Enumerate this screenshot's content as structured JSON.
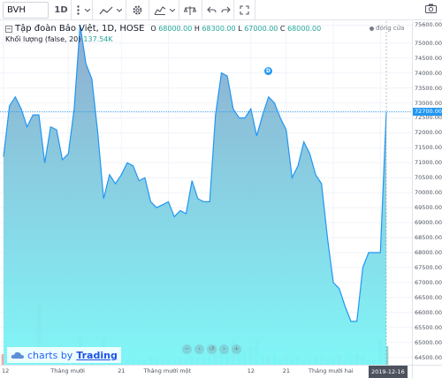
{
  "toolbar": {
    "symbol": "BVH",
    "interval": "1D",
    "more_icon": "more-vertical-icon",
    "chart_type_icon": "line-chart-icon",
    "settings_icon": "gear-icon",
    "indicators_icon": "indicators-icon",
    "compare_icon": "compare-icon",
    "undo_icon": "undo-icon",
    "redo_icon": "redo-icon",
    "fullscreen_icon": "fullscreen-icon",
    "snapshot_icon": "camera-icon"
  },
  "legend": {
    "title": "Tập đoàn Bảo Việt, 1D, HOSE",
    "o_label": "O",
    "o_value": "68000.00",
    "h_label": "H",
    "h_value": "68300.00",
    "l_label": "L",
    "l_value": "67000.00",
    "c_label": "C",
    "c_value": "68000.00",
    "volume_label": "Khối lượng (false, 20)",
    "volume_value": "137.54K"
  },
  "market_status": "đóng cửa",
  "dividend_marker": "D",
  "watermark": {
    "prefix": "charts by",
    "brand": "Trading"
  },
  "time_cursor": "2019-12-16",
  "colors": {
    "line": "#2196f3",
    "area_top": "#8ab7d6",
    "area_bottom": "#78f2f6",
    "volume_up": "#26a69a",
    "volume_down": "#ef5350",
    "last_price_bg": "#2196f3"
  },
  "chart_data": {
    "type": "area",
    "title": "Tập đoàn Bảo Việt, 1D, HOSE",
    "price_ticks": [
      "75600.00",
      "75000.00",
      "74500.00",
      "74000.00",
      "73500.00",
      "73000.00",
      "72500.00",
      "72000.00",
      "71500.00",
      "71000.00",
      "70500.00",
      "70000.00",
      "69500.00",
      "69000.00",
      "68500.00",
      "68000.00",
      "67500.00",
      "67000.00",
      "66500.00",
      "66000.00",
      "65500.00",
      "65000.00",
      "64500.00"
    ],
    "last_price": "72700.00",
    "time_ticks": [
      "12",
      "Tháng mười",
      "21",
      "Tháng mười một",
      "12",
      "21",
      "Tháng mười hai",
      "2"
    ],
    "ylim": [
      64400,
      75700
    ],
    "values": [
      71200,
      72900,
      73200,
      72800,
      72200,
      72600,
      72600,
      71000,
      72200,
      72100,
      71100,
      71300,
      72800,
      75600,
      74300,
      73800,
      72000,
      69800,
      70600,
      70300,
      70600,
      71000,
      70900,
      70400,
      70500,
      69700,
      69500,
      69600,
      69700,
      69200,
      69400,
      69300,
      70400,
      69800,
      69700,
      69700,
      72600,
      74000,
      73900,
      72800,
      72500,
      72500,
      72800,
      71900,
      72600,
      73200,
      73000,
      72500,
      72100,
      70500,
      70900,
      71700,
      71300,
      70600,
      70300,
      68500,
      67000,
      66800,
      66200,
      65700,
      65700,
      67500,
      68000,
      68000,
      68000,
      72700
    ],
    "volume_values": [
      0,
      0,
      0,
      0,
      0,
      0,
      0,
      0,
      0,
      0,
      0,
      0,
      0,
      0,
      0,
      0,
      0,
      0,
      0,
      0,
      0,
      0,
      0,
      0,
      0,
      0,
      0,
      0,
      0,
      0,
      0,
      0,
      0,
      0,
      0,
      0,
      0,
      0,
      0,
      0,
      0,
      0,
      0,
      0,
      0,
      0,
      0,
      0,
      0,
      0,
      0,
      0,
      0,
      0,
      0,
      0,
      0,
      0,
      0,
      0,
      0,
      0,
      0,
      0,
      0,
      0
    ]
  }
}
